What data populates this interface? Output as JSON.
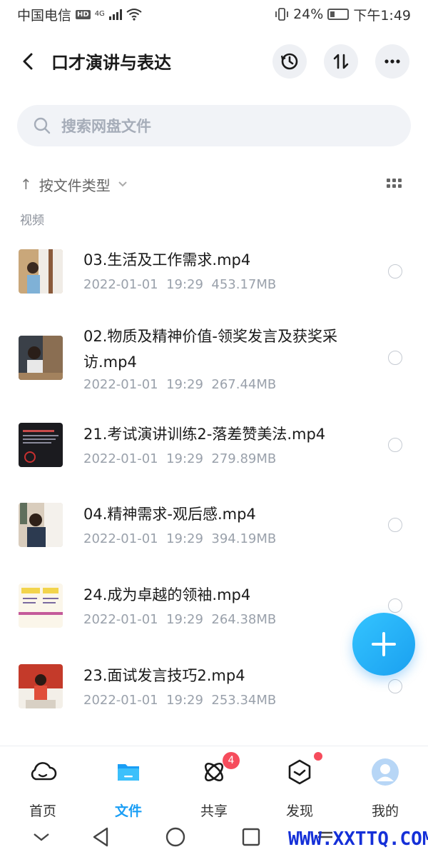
{
  "status_bar": {
    "carrier": "中国电信",
    "hd": "HD",
    "network": "4G",
    "battery": "24%",
    "time": "下午1:49"
  },
  "header": {
    "title": "口才演讲与表达",
    "icons": [
      "back-icon",
      "history-icon",
      "sort-icon",
      "more-icon"
    ]
  },
  "search": {
    "placeholder": "搜索网盘文件"
  },
  "sort": {
    "arrow": "↑",
    "label": "按文件类型"
  },
  "section_label": "视频",
  "files": [
    {
      "name": "03.生活及工作需求.mp4",
      "date": "2022-01-01",
      "time": "19:29",
      "size": "453.17MB"
    },
    {
      "name": "02.物质及精神价值-领奖发言及获奖采访.mp4",
      "date": "2022-01-01",
      "time": "19:29",
      "size": "267.44MB"
    },
    {
      "name": "21.考试演讲训练2-落差赞美法.mp4",
      "date": "2022-01-01",
      "time": "19:29",
      "size": "279.89MB"
    },
    {
      "name": "04.精神需求-观后感.mp4",
      "date": "2022-01-01",
      "time": "19:29",
      "size": "394.19MB"
    },
    {
      "name": "24.成为卓越的领袖.mp4",
      "date": "2022-01-01",
      "time": "19:29",
      "size": "264.38MB"
    },
    {
      "name": "23.面试发言技巧2.mp4",
      "date": "2022-01-01",
      "time": "19:29",
      "size": "253.34MB"
    }
  ],
  "bottom_nav": [
    {
      "label": "首页",
      "icon": "cloud-icon"
    },
    {
      "label": "文件",
      "icon": "folder-icon",
      "active": true
    },
    {
      "label": "共享",
      "icon": "atom-icon",
      "badge": "4"
    },
    {
      "label": "发现",
      "icon": "cube-icon",
      "dot": true
    },
    {
      "label": "我的",
      "icon": "avatar-icon"
    }
  ],
  "watermark": "WWW.XXTTQ.COM",
  "colors": {
    "accent": "#1a9ef5",
    "badge": "#f64c5c"
  }
}
